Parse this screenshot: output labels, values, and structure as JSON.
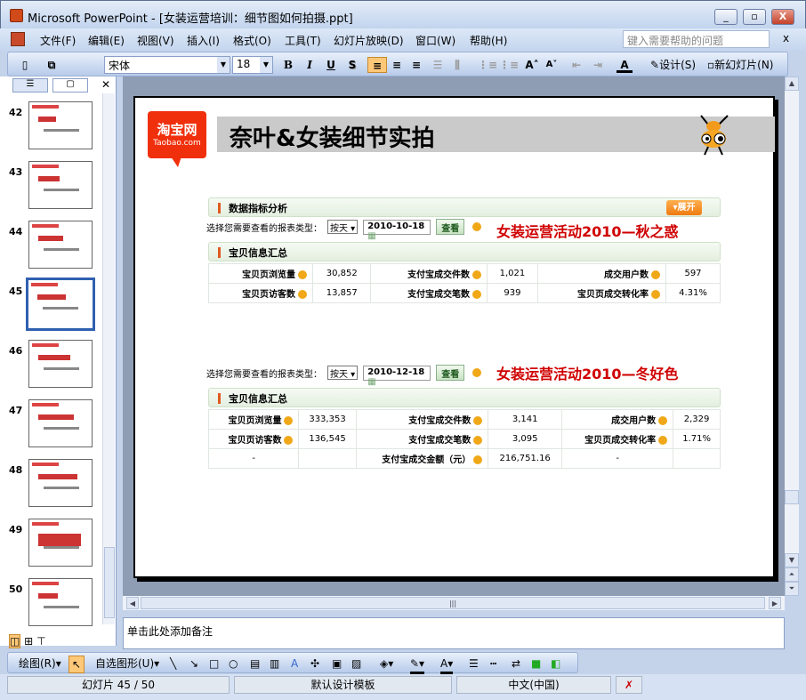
{
  "window": {
    "title": "Microsoft PowerPoint - [女装运营培训：细节图如何拍摄.ppt]",
    "minimize": "_",
    "restore": "▫",
    "close": "X"
  },
  "menu": [
    "文件(F)",
    "编辑(E)",
    "视图(V)",
    "插入(I)",
    "格式(O)",
    "工具(T)",
    "幻灯片放映(D)",
    "窗口(W)",
    "帮助(H)"
  ],
  "help": {
    "placeholder": "键入需要帮助的问题",
    "close": "x"
  },
  "toolbar": {
    "font": "宋体",
    "size": "18",
    "bold": "B",
    "italic": "I",
    "underline": "U",
    "shadow": "S",
    "design": "设计(S)",
    "new_slide": "新幻灯片(N)"
  },
  "thumbnails": [
    {
      "num": "42"
    },
    {
      "num": "43"
    },
    {
      "num": "44"
    },
    {
      "num": "45",
      "selected": true
    },
    {
      "num": "46"
    },
    {
      "num": "47"
    },
    {
      "num": "48"
    },
    {
      "num": "49"
    },
    {
      "num": "50"
    }
  ],
  "slide": {
    "logo": {
      "cn": "淘宝网",
      "en": "Taobao.com"
    },
    "title": "奈叶&女装细节实拍",
    "section1": {
      "panel_title": "数据指标分析",
      "expand": "展开",
      "select_label": "选择您需要查看的报表类型：",
      "select_value": "按天",
      "date": "2010-10-18",
      "view": "查看",
      "event_title": "女装运营活动2010—秋之惑",
      "summary_title": "宝贝信息汇总",
      "rows": [
        [
          "宝贝页浏览量",
          "30,852",
          "支付宝成交件数",
          "1,021",
          "成交用户数",
          "597"
        ],
        [
          "宝贝页访客数",
          "13,857",
          "支付宝成交笔数",
          "939",
          "宝贝页成交转化率",
          "4.31%"
        ]
      ]
    },
    "section2": {
      "select_label": "选择您需要查看的报表类型：",
      "select_value": "按天",
      "date": "2010-12-18",
      "view": "查看",
      "event_title": "女装运营活动2010—冬好色",
      "summary_title": "宝贝信息汇总",
      "rows": [
        [
          "宝贝页浏览量",
          "333,353",
          "支付宝成交件数",
          "3,141",
          "成交用户数",
          "2,329"
        ],
        [
          "宝贝页访客数",
          "136,545",
          "支付宝成交笔数",
          "3,095",
          "宝贝页成交转化率",
          "1.71%"
        ],
        [
          "-",
          "",
          "支付宝成交金额（元）",
          "216,751.16",
          "-",
          ""
        ]
      ]
    }
  },
  "notes": {
    "placeholder": "单击此处添加备注"
  },
  "drawbar": {
    "draw": "绘图(R)",
    "autoshapes": "自选图形(U)"
  },
  "status": {
    "slide": "幻灯片 45 / 50",
    "template": "默认设计模板",
    "language": "中文(中国)"
  }
}
